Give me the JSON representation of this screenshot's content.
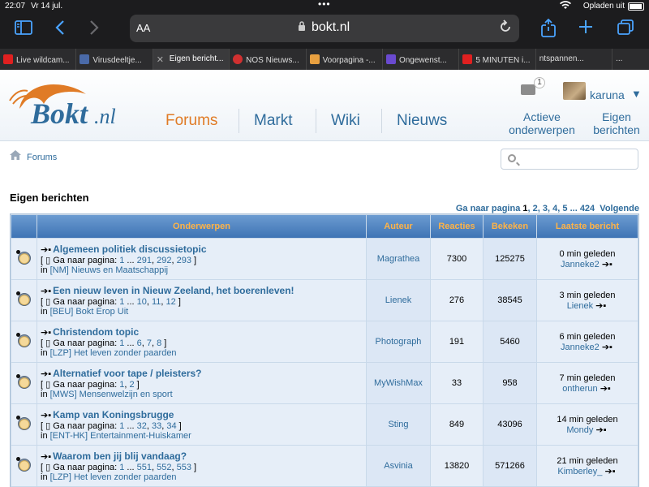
{
  "status_bar": {
    "time": "22:07",
    "date": "Vr 14 jul.",
    "charging": "Opladen uit"
  },
  "browser": {
    "aa_label": "AA",
    "url": "bokt.nl",
    "tabs": [
      {
        "label": "Live wildcam...",
        "icon_color": "#e02020"
      },
      {
        "label": "Virusdeeltje...",
        "icon_color": "#4a6aa8"
      },
      {
        "label": "Eigen bericht...",
        "icon_color": "#888888",
        "active": true
      },
      {
        "label": "NOS Nieuws...",
        "icon_color": "#d03030"
      },
      {
        "label": "Voorpagina -...",
        "icon_color": "#e8a040"
      },
      {
        "label": "Ongewenst...",
        "icon_color": "#6a4ad0"
      },
      {
        "label": "5 MINUTEN i...",
        "icon_color": "#e02020"
      },
      {
        "label": "ntspannen...",
        "icon_color": "#2c2c2e"
      },
      {
        "label": "...",
        "icon_color": "#2c2c2e"
      }
    ]
  },
  "header": {
    "logo_text": "Bokt.nl",
    "nav": [
      "Forums",
      "Markt",
      "Wiki",
      "Nieuws"
    ],
    "mail_count": "1",
    "username": "karuna",
    "user_caret": "▼",
    "active_topics": [
      "Actieve",
      "onderwerpen"
    ],
    "own_posts": [
      "Eigen",
      "berichten"
    ]
  },
  "breadcrumb": {
    "label": "Forums"
  },
  "page_title": "Eigen berichten",
  "pagination": {
    "prefix": "Ga naar pagina",
    "current": "1",
    "pages": [
      "2",
      "3",
      "4",
      "5"
    ],
    "ellipsis": "...",
    "last": "424",
    "next": "Volgende"
  },
  "table": {
    "headers": [
      "Onderwerpen",
      "Auteur",
      "Reacties",
      "Bekeken",
      "Laatste bericht"
    ],
    "pages_prefix": "Ga naar pagina:",
    "in_label": "in",
    "rows": [
      {
        "title": "Algemeen politiek discussietopic",
        "pages": [
          "1",
          "291",
          "292",
          "293"
        ],
        "forum": "[NM] Nieuws en Maatschappij",
        "author": "Magrathea",
        "replies": "7300",
        "views": "125275",
        "last_time": "0 min geleden",
        "last_user": "Janneke2"
      },
      {
        "title": "Een nieuw leven in Nieuw Zeeland, het boerenleven!",
        "pages": [
          "1",
          "10",
          "11",
          "12"
        ],
        "forum": "[BEU] Bokt Erop Uit",
        "author": "Lienek",
        "replies": "276",
        "views": "38545",
        "last_time": "3 min geleden",
        "last_user": "Lienek"
      },
      {
        "title": "Christendom topic",
        "pages": [
          "1",
          "6",
          "7",
          "8"
        ],
        "forum": "[LZP] Het leven zonder paarden",
        "author": "Photograph",
        "replies": "191",
        "views": "5460",
        "last_time": "6 min geleden",
        "last_user": "Janneke2"
      },
      {
        "title": "Alternatief voor tape / pleisters?",
        "pages": [
          "1",
          "2"
        ],
        "forum": "[MWS] Mensenwelzijn en sport",
        "author": "MyWishMax",
        "replies": "33",
        "views": "958",
        "last_time": "7 min geleden",
        "last_user": "ontherun"
      },
      {
        "title": "Kamp van Koningsbrugge",
        "pages": [
          "1",
          "32",
          "33",
          "34"
        ],
        "forum": "[ENT-HK] Entertainment-Huiskamer",
        "author": "Sting",
        "replies": "849",
        "views": "43096",
        "last_time": "14 min geleden",
        "last_user": "Mondy"
      },
      {
        "title": "Waarom ben jij blij vandaag?",
        "pages": [
          "1",
          "551",
          "552",
          "553"
        ],
        "forum": "[LZP] Het leven zonder paarden",
        "author": "Asvinia",
        "replies": "13820",
        "views": "571266",
        "last_time": "21 min geleden",
        "last_user": "Kimberley_"
      }
    ]
  }
}
